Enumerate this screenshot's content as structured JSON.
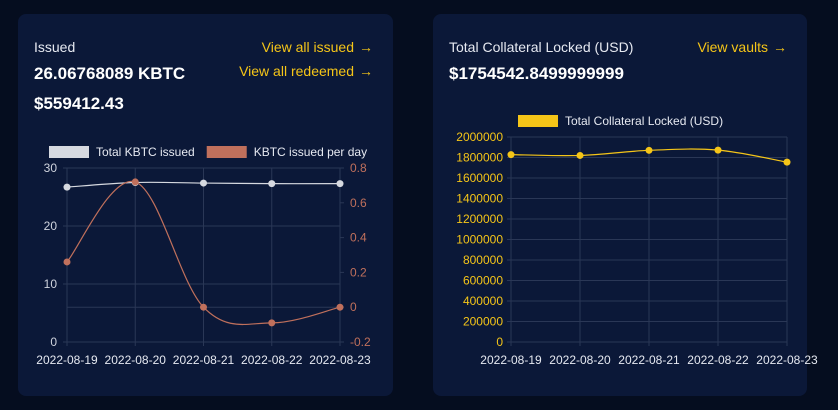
{
  "issued_card": {
    "title": "Issued",
    "total_kbtc": "26.06768089 KBTC",
    "total_usd": "$559412.43",
    "view_issued_label": "View all issued",
    "view_redeemed_label": "View all redeemed",
    "arrow_icon": "→"
  },
  "collateral_card": {
    "title": "Total Collateral Locked (USD)",
    "total_usd": "$1754542.8499999999",
    "view_vaults_label": "View vaults",
    "arrow_icon": "→"
  },
  "chart_data": [
    {
      "type": "line",
      "categories": [
        "2022-08-19",
        "2022-08-20",
        "2022-08-21",
        "2022-08-22",
        "2022-08-23"
      ],
      "series": [
        {
          "name": "Total KBTC issued",
          "axis": "left",
          "color": "#d6d9e0",
          "values": [
            26.7,
            27.5,
            27.4,
            27.3,
            27.3
          ]
        },
        {
          "name": "KBTC issued per day",
          "axis": "right",
          "color": "#c0705c",
          "values": [
            0.26,
            0.72,
            0.0,
            -0.09,
            0.0
          ]
        }
      ],
      "y_left": {
        "min": 0,
        "max": 30,
        "ticks": [
          "0",
          "10",
          "20",
          "30"
        ]
      },
      "y_right": {
        "min": -0.2,
        "max": 0.8,
        "ticks": [
          "-0.2",
          "0",
          "0.2",
          "0.4",
          "0.6",
          "0.8"
        ]
      },
      "legend_position": "top",
      "grid": true,
      "title": ""
    },
    {
      "type": "line",
      "categories": [
        "2022-08-19",
        "2022-08-20",
        "2022-08-21",
        "2022-08-22",
        "2022-08-23"
      ],
      "series": [
        {
          "name": "Total Collateral Locked (USD)",
          "color": "#f5c518",
          "values": [
            1828000,
            1820000,
            1870000,
            1872000,
            1754542.85
          ]
        }
      ],
      "ylim": [
        0,
        2000000
      ],
      "y_ticks": [
        "0",
        "200000",
        "400000",
        "600000",
        "800000",
        "1000000",
        "1200000",
        "1400000",
        "1600000",
        "1800000",
        "2000000"
      ],
      "legend_position": "top",
      "grid": true,
      "title": ""
    }
  ]
}
